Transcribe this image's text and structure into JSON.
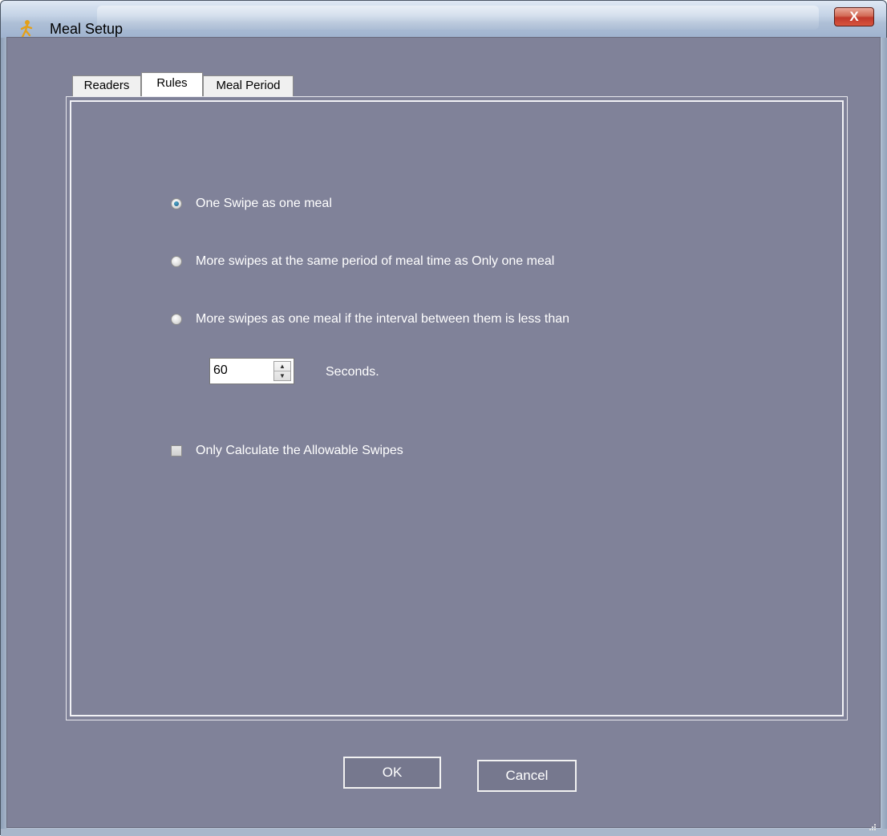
{
  "window": {
    "title": "Meal Setup",
    "close_label": "X"
  },
  "tabs": [
    {
      "label": "Readers",
      "active": false
    },
    {
      "label": "Rules",
      "active": true
    },
    {
      "label": "Meal Period",
      "active": false
    }
  ],
  "rules": {
    "options": [
      {
        "label": "One Swipe as one meal",
        "checked": true
      },
      {
        "label": "More swipes at the same period of meal time as Only one meal",
        "checked": false
      },
      {
        "label": "More swipes as one meal if the interval between them is less than",
        "checked": false
      }
    ],
    "interval": {
      "value": "60",
      "unit_label": "Seconds."
    },
    "allowable_checkbox": {
      "label": "Only Calculate the Allowable Swipes",
      "checked": false
    }
  },
  "buttons": {
    "ok_label": "OK",
    "cancel_label": "Cancel"
  },
  "colors": {
    "client_background": "#808299",
    "frame": "#b9c4d6"
  }
}
